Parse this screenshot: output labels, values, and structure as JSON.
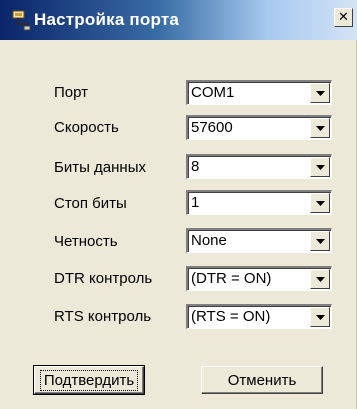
{
  "window": {
    "title": "Настройка порта",
    "close_glyph": "✕",
    "icon": "port-settings-icon"
  },
  "fields": [
    {
      "id": "port",
      "label": "Порт",
      "value": "COM1"
    },
    {
      "id": "speed",
      "label": "Скорость",
      "value": "57600"
    },
    {
      "id": "data-bits",
      "label": "Биты данных",
      "value": "8"
    },
    {
      "id": "stop-bits",
      "label": "Стоп биты",
      "value": "1"
    },
    {
      "id": "parity",
      "label": "Четность",
      "value": "None"
    },
    {
      "id": "dtr-control",
      "label": "DTR контроль",
      "value": "(DTR = ON)"
    },
    {
      "id": "rts-control",
      "label": "RTS контроль",
      "value": "(RTS = ON)"
    }
  ],
  "buttons": {
    "confirm_label": "Подтвердить",
    "cancel_label": "Отменить"
  },
  "colors": {
    "title_bar_start": "#0a246a",
    "title_bar_end": "#a6caf0",
    "face": "#ece9d8"
  }
}
